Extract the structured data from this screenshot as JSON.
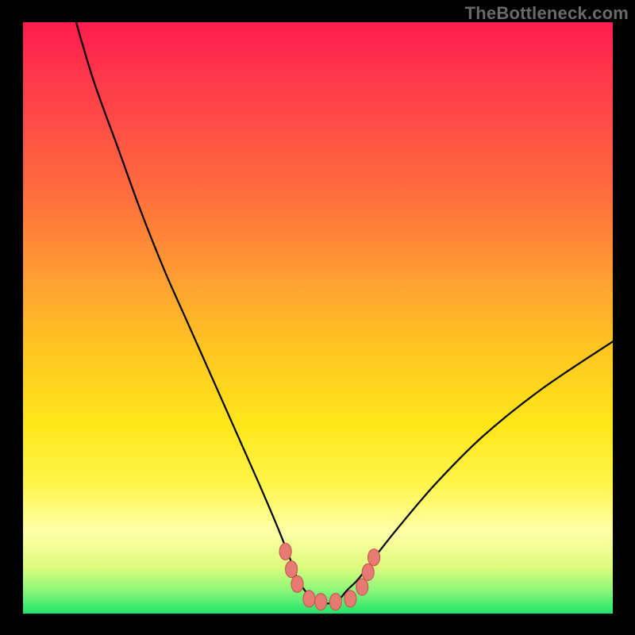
{
  "watermark": "TheBottleneck.com",
  "colors": {
    "background_frame": "#000000",
    "gradient_top": "#ff1b50",
    "gradient_mid": "#ffe61a",
    "gradient_bottom": "#20e46b",
    "curve": "#000000",
    "marker_fill": "#e77a72",
    "marker_stroke": "#c55a53"
  },
  "chart_data": {
    "type": "line",
    "title": "",
    "xlabel": "",
    "ylabel": "",
    "xlim": [
      0,
      100
    ],
    "ylim": [
      0,
      100
    ],
    "notes": "V-shaped curve with flat minimum near x≈47–57, y≈2. Left arm reaches y≈100 at x≈9; right arm reaches y≈46 at x=100. Markers cluster near the trough.",
    "series": [
      {
        "name": "curve",
        "x": [
          9,
          12,
          16,
          20,
          24,
          28,
          32,
          36,
          40,
          43,
          45,
          47,
          50,
          53,
          55,
          57,
          60,
          64,
          70,
          78,
          88,
          100
        ],
        "y": [
          100,
          90,
          79,
          68,
          58,
          49,
          40,
          31,
          22,
          15,
          10,
          5,
          2,
          2,
          4,
          6,
          10,
          15,
          22,
          30,
          38,
          46
        ]
      }
    ],
    "markers": {
      "name": "highlight-points",
      "points": [
        {
          "x": 44.5,
          "y": 10.5
        },
        {
          "x": 45.5,
          "y": 7.5
        },
        {
          "x": 46.5,
          "y": 5.0
        },
        {
          "x": 48.5,
          "y": 2.5
        },
        {
          "x": 50.5,
          "y": 2.0
        },
        {
          "x": 53.0,
          "y": 2.0
        },
        {
          "x": 55.5,
          "y": 2.5
        },
        {
          "x": 57.5,
          "y": 4.5
        },
        {
          "x": 58.5,
          "y": 7.0
        },
        {
          "x": 59.5,
          "y": 9.5
        }
      ]
    }
  }
}
